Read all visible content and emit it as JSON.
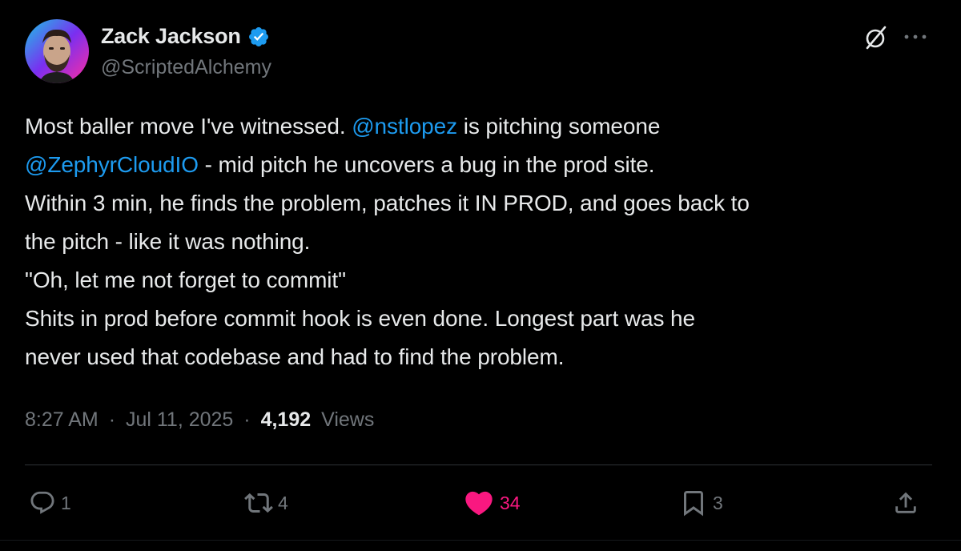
{
  "author": {
    "display_name": "Zack Jackson",
    "handle": "@ScriptedAlchemy",
    "verified": true
  },
  "tweet": {
    "lines": [
      [
        {
          "text": "Most baller move I've witnessed. ",
          "type": "text"
        },
        {
          "text": "@nstlopez",
          "type": "mention"
        },
        {
          "text": " is pitching someone",
          "type": "text"
        }
      ],
      [
        {
          "text": "@ZephyrCloudIO",
          "type": "mention"
        },
        {
          "text": " - mid pitch he uncovers a bug in the prod site.",
          "type": "text"
        }
      ],
      [
        {
          "text": "Within 3 min, he finds the problem, patches it IN PROD, and goes back to",
          "type": "text"
        }
      ],
      [
        {
          "text": "the pitch - like it was nothing.",
          "type": "text"
        }
      ],
      [
        {
          "text": "\"Oh, let me not forget to commit\"",
          "type": "text"
        }
      ],
      [
        {
          "text": "Shits in prod before commit hook is even done. Longest part was he",
          "type": "text"
        }
      ],
      [
        {
          "text": "never used that codebase and had to find the problem.",
          "type": "text"
        }
      ]
    ]
  },
  "meta": {
    "time": "8:27 AM",
    "separator": "·",
    "date": "Jul 11, 2025",
    "views_count": "4,192",
    "views_label": "Views"
  },
  "actions": {
    "reply": {
      "icon": "reply-icon",
      "count": "1"
    },
    "retweet": {
      "icon": "retweet-icon",
      "count": "4"
    },
    "like": {
      "icon": "heart-icon",
      "count": "34",
      "active": true
    },
    "bookmark": {
      "icon": "bookmark-icon",
      "count": "3"
    },
    "share": {
      "icon": "share-icon"
    }
  },
  "colors": {
    "background": "#000000",
    "text": "#e7e9ea",
    "secondary": "#71767b",
    "mention": "#1d9bf0",
    "like": "#f91880",
    "verified": "#1d9bf0",
    "divider": "#2f3336"
  },
  "icons": {
    "verified": "verified-badge-icon",
    "grok": "grok-icon",
    "more": "more-icon"
  }
}
